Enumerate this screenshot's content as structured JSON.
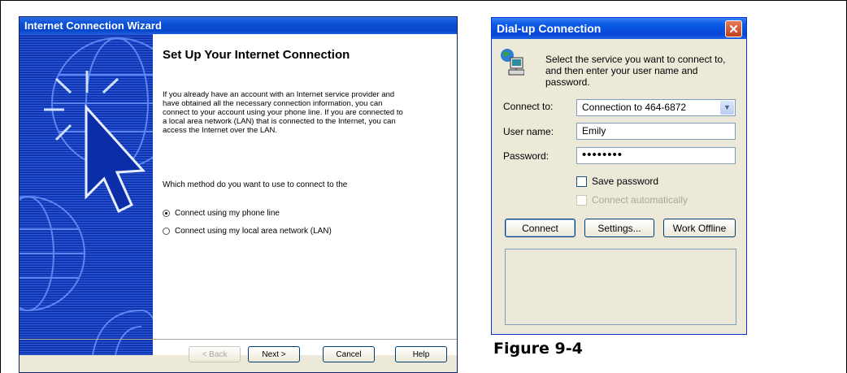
{
  "wizard": {
    "title": "Internet Connection Wizard",
    "heading": "Set Up Your Internet Connection",
    "body": "If you already have an account with an Internet service provider and have obtained all the necessary connection information, you can connect to your account using your phone line. If you are connected to a local area network (LAN) that is connected to the Internet, you can access the Internet over the LAN.",
    "question": "Which method do you want to use to connect to the",
    "options": [
      {
        "label": "Connect using my phone line",
        "selected": true
      },
      {
        "label": "Connect using my local area network (LAN)",
        "selected": false
      }
    ],
    "buttons": {
      "back": "< Back",
      "next": "Next >",
      "cancel": "Cancel",
      "help": "Help"
    }
  },
  "dialup": {
    "title": "Dial-up Connection",
    "close": "✕",
    "intro": "Select the service you want to connect to, and then enter your user name and password.",
    "connect_to_label": "Connect to:",
    "connect_to_value": "Connection to 464-6872",
    "username_label": "User name:",
    "username_value": "Emily",
    "password_label": "Password:",
    "password_value": "••••••••",
    "save_password": "Save password",
    "connect_auto": "Connect automatically",
    "buttons": {
      "connect": "Connect",
      "settings": "Settings...",
      "offline": "Work Offline"
    }
  },
  "caption": "Figure 9-4"
}
